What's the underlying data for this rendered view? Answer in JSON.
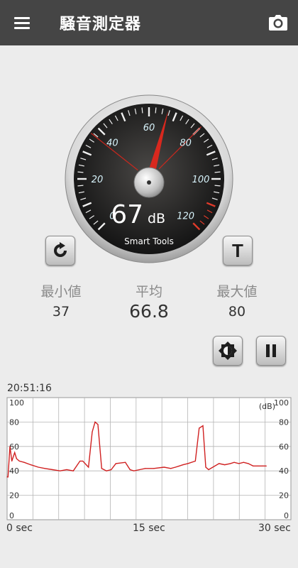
{
  "app": {
    "title": "騒音測定器"
  },
  "gauge": {
    "value": 67,
    "value_text": "67",
    "unit": "dB",
    "brand": "Smart Tools",
    "min_line": 37,
    "max_line": 80,
    "scale_labels": [
      "0",
      "20",
      "40",
      "60",
      "80",
      "100",
      "120"
    ]
  },
  "stats": {
    "min_label": "最小値",
    "min_value": "37",
    "avg_label": "平均",
    "avg_value": "66.8",
    "max_label": "最大値",
    "max_value": "80"
  },
  "controls": {
    "reset_label": "",
    "t_label": "T"
  },
  "graph": {
    "timestamp": "20:51:16",
    "unit_label": "(dB)",
    "x_labels": [
      "0 sec",
      "15 sec",
      "30 sec"
    ]
  },
  "chart_data": {
    "type": "line",
    "ylim": [
      0,
      100
    ],
    "xlim": [
      0,
      30
    ],
    "y_ticks": [
      "100",
      "80",
      "60",
      "40",
      "20",
      "0"
    ],
    "grid": true,
    "x": [
      0,
      0.1,
      0.3,
      0.5,
      0.8,
      1.0,
      1.3,
      1.8,
      2.5,
      3.3,
      4.0,
      4.8,
      5.6,
      6.3,
      7.0,
      7.7,
      8.0,
      8.6,
      9.0,
      9.3,
      9.6,
      10.0,
      10.5,
      11.0,
      11.5,
      12.5,
      13.0,
      13.4,
      14.0,
      14.6,
      15.5,
      16.6,
      17.3,
      17.8,
      18.2,
      18.6,
      19.1,
      19.9,
      20.3,
      20.7,
      21.0,
      21.3,
      22.4,
      23.0,
      23.6,
      24.0,
      24.5,
      25.0,
      25.5,
      26.0,
      26.5,
      27.0,
      27.4
    ],
    "values": [
      35,
      35,
      60,
      48,
      55,
      50,
      48,
      47,
      45,
      43,
      42,
      41,
      40,
      41,
      40,
      48,
      48,
      43,
      72,
      80,
      78,
      42,
      40,
      41,
      46,
      47,
      41,
      40,
      41,
      42,
      42,
      43,
      42,
      43,
      44,
      45,
      46,
      48,
      75,
      77,
      43,
      41,
      46,
      45,
      46,
      47,
      46,
      47,
      46,
      44,
      44,
      44,
      44
    ]
  }
}
